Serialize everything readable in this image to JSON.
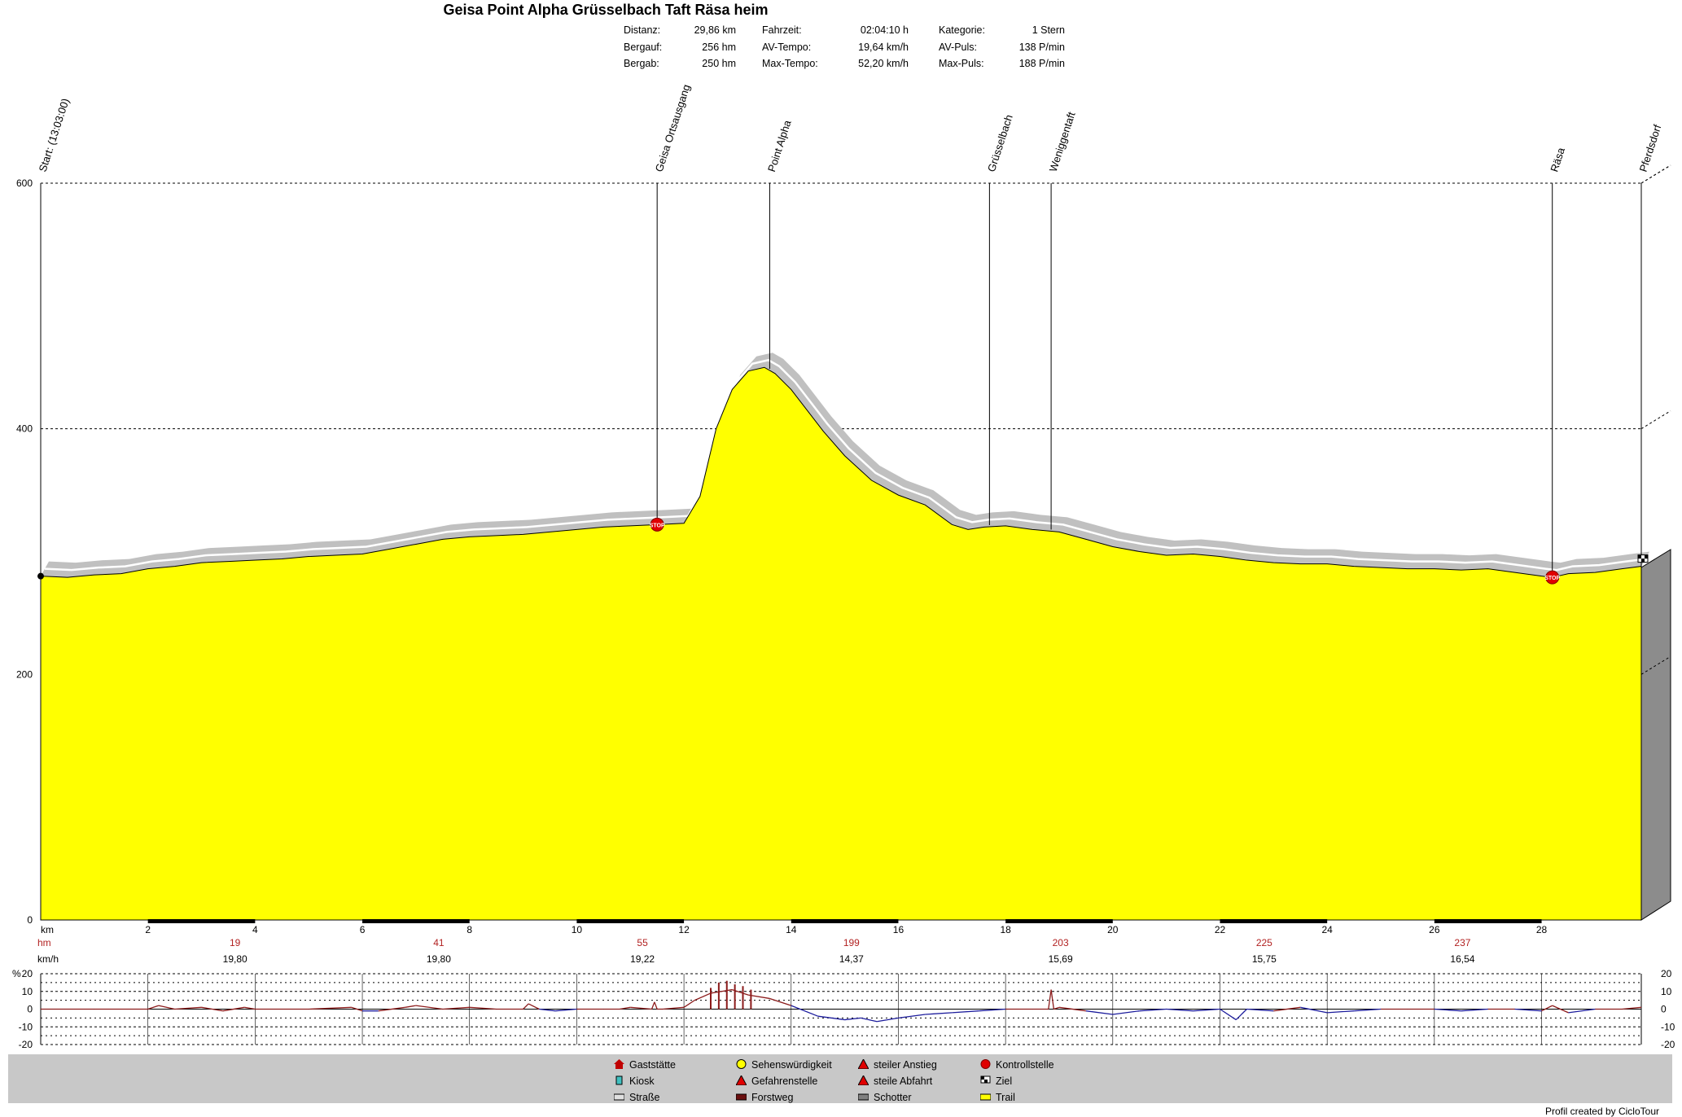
{
  "chart_data": {
    "type": "area",
    "title": "Geisa Point Alpha Grüsselbach Taft Räsa heim",
    "stats": [
      {
        "label": "Distanz:",
        "value": "29,86 km"
      },
      {
        "label": "Bergauf:",
        "value": "256 hm"
      },
      {
        "label": "Bergab:",
        "value": "250 hm"
      },
      {
        "label": "Fahrzeit:",
        "value": "02:04:10 h"
      },
      {
        "label": "AV-Tempo:",
        "value": "19,64 km/h"
      },
      {
        "label": "Max-Tempo:",
        "value": "52,20 km/h"
      },
      {
        "label": "Kategorie:",
        "value": "1 Stern"
      },
      {
        "label": "AV-Puls:",
        "value": "138 P/min"
      },
      {
        "label": "Max-Puls:",
        "value": "188 P/min"
      }
    ],
    "xlabel": "km",
    "xlim": [
      0,
      29.86
    ],
    "ylim": [
      0,
      600
    ],
    "yticks": [
      0,
      200,
      400,
      600
    ],
    "xticks": [
      2,
      4,
      6,
      8,
      10,
      12,
      14,
      16,
      18,
      20,
      22,
      24,
      26,
      28
    ],
    "elevation": {
      "x": [
        0,
        0.5,
        1,
        1.5,
        2,
        2.5,
        3,
        3.5,
        4,
        4.5,
        5,
        5.5,
        6,
        6.5,
        7,
        7.5,
        8,
        8.5,
        9,
        9.5,
        10,
        10.5,
        11,
        11.5,
        12,
        12.3,
        12.6,
        12.9,
        13.2,
        13.5,
        13.7,
        14,
        14.3,
        14.6,
        15,
        15.5,
        16,
        16.5,
        17,
        17.3,
        17.6,
        18,
        18.5,
        19,
        19.5,
        20,
        20.5,
        21,
        21.5,
        22,
        22.5,
        23,
        23.5,
        24,
        24.5,
        25,
        25.5,
        26,
        26.5,
        27,
        27.5,
        28,
        28.2,
        28.5,
        29,
        29.5,
        29.86
      ],
      "y": [
        280,
        279,
        281,
        282,
        286,
        288,
        291,
        292,
        293,
        294,
        296,
        297,
        298,
        302,
        306,
        310,
        312,
        313,
        314,
        316,
        318,
        320,
        321,
        322,
        323,
        345,
        400,
        432,
        447,
        450,
        445,
        432,
        415,
        398,
        378,
        358,
        346,
        338,
        322,
        318,
        320,
        321,
        318,
        316,
        310,
        304,
        300,
        297,
        298,
        296,
        293,
        291,
        290,
        290,
        288,
        287,
        286,
        286,
        285,
        286,
        283,
        280,
        279,
        282,
        283,
        286,
        288
      ]
    },
    "waypoints": [
      {
        "x": 0,
        "label": "Start: (13:03:00)"
      },
      {
        "x": 11.5,
        "label": "Geisa Ortsausgang"
      },
      {
        "x": 13.6,
        "label": "Point Alpha"
      },
      {
        "x": 17.7,
        "label": "Grüsselbach"
      },
      {
        "x": 18.85,
        "label": "Weniggentaft"
      },
      {
        "x": 28.2,
        "label": "Räsa"
      },
      {
        "x": 29.86,
        "label": "Pferdsdorf"
      }
    ],
    "segments": {
      "hm_label": "hm",
      "kmh_label": "km/h",
      "centers": [
        3.2,
        7,
        10.8,
        14.7,
        18.6,
        22.4,
        26.1
      ],
      "hm": [
        "19",
        "41",
        "55",
        "199",
        "203",
        "225",
        "237"
      ],
      "kmh": [
        "19,80",
        "19,80",
        "19,22",
        "14,37",
        "15,69",
        "15,75",
        "16,54"
      ]
    },
    "gradient": {
      "unit_label": "%",
      "ylim": [
        -20,
        20
      ],
      "ticks": [
        20,
        10,
        0,
        -10,
        -20
      ],
      "x": [
        0,
        1,
        2,
        2.2,
        2.5,
        3,
        3.4,
        3.8,
        4,
        5,
        5.8,
        6,
        6.3,
        6.8,
        7,
        7.5,
        8,
        8.5,
        9,
        9,
        9.1,
        9.3,
        9.6,
        10,
        10.5,
        10.8,
        11,
        11.4,
        11.45,
        11.5,
        11.6,
        12,
        12.2,
        12.5,
        12.9,
        13.2,
        13.6,
        14,
        14.5,
        15,
        15.3,
        15.6,
        16,
        16.5,
        17,
        17.5,
        18,
        18.5,
        18.8,
        18.85,
        18.9,
        19,
        19.5,
        20,
        20.5,
        21,
        21.5,
        22,
        22.3,
        22.5,
        23,
        23.5,
        24,
        24.5,
        25,
        25.5,
        26,
        26.5,
        27,
        27.5,
        28,
        28.2,
        28.5,
        29,
        29.5,
        29.86
      ],
      "y": [
        0,
        0,
        0,
        2,
        0,
        1,
        -1,
        1,
        0,
        0,
        1,
        -1,
        -1,
        1,
        2,
        0,
        1,
        0,
        0,
        0,
        3,
        0,
        -1,
        0,
        0,
        0,
        1,
        0,
        4,
        0,
        0,
        1,
        5,
        9,
        11,
        8,
        6,
        2,
        -4,
        -6,
        -5,
        -7,
        -5,
        -3,
        -2,
        -1,
        0,
        0,
        0,
        11,
        0,
        1,
        -1,
        -3,
        -1,
        0,
        -1,
        0,
        -6,
        0,
        -1,
        1,
        -2,
        -1,
        0,
        0,
        0,
        -1,
        0,
        0,
        -1,
        2,
        -2,
        0,
        0,
        1
      ]
    },
    "grade_markers": [
      {
        "x": 12.5,
        "y": 12
      },
      {
        "x": 12.65,
        "y": 15
      },
      {
        "x": 12.8,
        "y": 16
      },
      {
        "x": 12.95,
        "y": 14
      },
      {
        "x": 13.1,
        "y": 13
      },
      {
        "x": 13.25,
        "y": 11
      }
    ],
    "stops": [
      11.5,
      28.2
    ]
  },
  "colors": {
    "trail": "#ffff00",
    "road_band": "#c0c0c0",
    "hm_text": "#b22222",
    "gradient_up": "#8b1a1a",
    "gradient_down": "#1c1c9c",
    "panel": "#c8c8c8",
    "side": "#8c8c8c"
  },
  "legend": [
    {
      "label": "Gaststätte",
      "icon": "house-icon",
      "col": 0,
      "row": 0
    },
    {
      "label": "Kiosk",
      "icon": "kiosk-icon",
      "col": 0,
      "row": 1
    },
    {
      "label": "Straße",
      "icon": "road-swatch",
      "col": 0,
      "row": 2
    },
    {
      "label": "Sehenswürdigkeit",
      "icon": "smiley-icon",
      "col": 1,
      "row": 0
    },
    {
      "label": "Gefahrenstelle",
      "icon": "warning-icon",
      "col": 1,
      "row": 1
    },
    {
      "label": "Forstweg",
      "icon": "forest-road-swatch",
      "col": 1,
      "row": 2
    },
    {
      "label": "steiler Anstieg",
      "icon": "steep-climb-icon",
      "col": 2,
      "row": 0
    },
    {
      "label": "steile Abfahrt",
      "icon": "steep-descent-icon",
      "col": 2,
      "row": 1
    },
    {
      "label": "Schotter",
      "icon": "gravel-swatch",
      "col": 2,
      "row": 2
    },
    {
      "label": "Kontrollstelle",
      "icon": "stop-icon",
      "col": 3,
      "row": 0
    },
    {
      "label": "Ziel",
      "icon": "finish-flag-icon",
      "col": 3,
      "row": 1
    },
    {
      "label": "Trail",
      "icon": "trail-swatch",
      "col": 3,
      "row": 2
    }
  ],
  "credit": "Profil created by CicloTour"
}
